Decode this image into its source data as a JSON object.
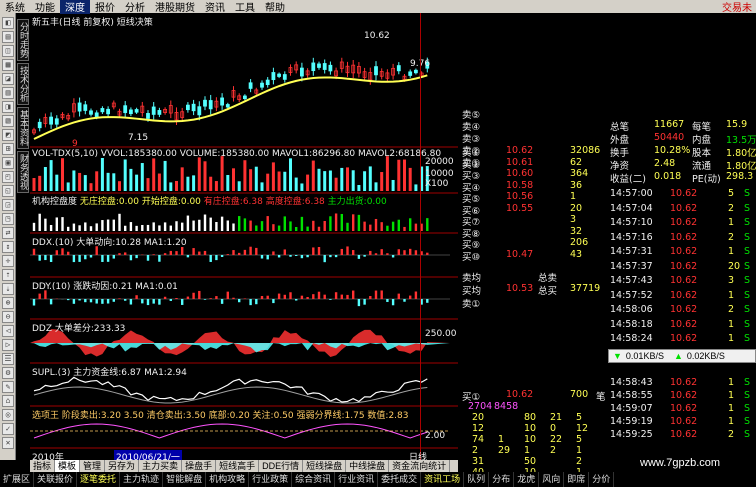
{
  "menu": {
    "items": [
      "系统",
      "功能",
      "深度",
      "报价",
      "分析",
      "港股期货",
      "资讯",
      "工具",
      "帮助"
    ],
    "active": 2,
    "trade_label": "交易未"
  },
  "vtabs": [
    "分时走势",
    "技术分析",
    "基本资料",
    "财务透视"
  ],
  "chart": {
    "title": "新五丰(日线 前复权) 短线决策",
    "mark_high": "10.62",
    "mark_low": "7.15",
    "mark_right": "9.76",
    "mark_day": "9",
    "vol_title": "VOL-TDX(5,10) VVOL:185380.00 VOLUME:185380.00 MAVOL1:86296.80 MAVOL2:68186.80",
    "vol_axis": [
      "20000",
      "10000",
      "X100"
    ],
    "jigou_title_1": "机构控盘度",
    "jigou_title_2": "无庄控盘:0.00 开始控盘:0.00",
    "jigou_title_3": "有庄控盘:6.38 高度控盘:6.38",
    "jigou_title_4": "主力出货:0.00",
    "ddx_title": "DDX.(10) 大单动向:10.28 MA1:1.20",
    "ddy_title": "DDY.(10) 涨跌动因:0.21 MA1:0.01",
    "ddz_title": "DDZ 大单差分:233.33",
    "ddz_axis": "250.00",
    "supl_title": "SUPL.(3) 主力资金线:6.87 MA1:2.94",
    "xuan_title": "选项王 阶段卖出:3.20 3.50 清仓卖出:3.50 底部:0.20 关注:0.50 强弱分界线:1.75 数值:2.83",
    "xuan_axis": "2.00",
    "year_label": "2010年",
    "date_label": "2010/06/21/一",
    "period_label": "日线"
  },
  "quote": {
    "sells": [
      {
        "label": "卖⑤",
        "price": "",
        "vol": ""
      },
      {
        "label": "卖④",
        "price": "",
        "vol": ""
      },
      {
        "label": "卖③",
        "price": "",
        "vol": ""
      },
      {
        "label": "卖②",
        "price": "",
        "vol": ""
      },
      {
        "label": "卖①",
        "price": "",
        "vol": ""
      }
    ],
    "buys": [
      {
        "label": "买①",
        "price": "10.62",
        "vol": "32086"
      },
      {
        "label": "买②",
        "price": "10.61",
        "vol": "62"
      },
      {
        "label": "买③",
        "price": "10.60",
        "vol": "364"
      },
      {
        "label": "买④",
        "price": "10.58",
        "vol": "36"
      },
      {
        "label": "买⑤",
        "price": "10.56",
        "vol": "1"
      },
      {
        "label": "买⑥",
        "price": "10.55",
        "vol": "20"
      },
      {
        "label": "买⑦",
        "price": "",
        "vol": "3"
      },
      {
        "label": "买⑧",
        "price": "",
        "vol": "32"
      },
      {
        "label": "买⑨",
        "price": "",
        "vol": "206"
      },
      {
        "label": "买⑩",
        "price": "10.47",
        "vol": "43"
      }
    ],
    "avg_sell_label": "卖均",
    "avg_buy_label": "买均",
    "avg_buy_price": "10.53",
    "total_sell_label": "总卖",
    "total_buy_label": "总买",
    "total_buy_vol": "37719",
    "sell_short": "卖①",
    "buy1_label": "买①",
    "buy1_price": "10.62",
    "buy1_vol": "700",
    "buy1_unit": "笔",
    "queue_head": [
      "2704",
      "8458"
    ],
    "queue": [
      [
        "20",
        "",
        "80",
        "21",
        "5"
      ],
      [
        "12",
        "",
        "10",
        "0",
        "12"
      ],
      [
        "74",
        "1",
        "10",
        "22",
        "5"
      ],
      [
        "2",
        "29",
        "1",
        "2",
        "1"
      ],
      [
        "31",
        "",
        "50",
        "",
        "2"
      ],
      [
        "40",
        "",
        "10",
        "",
        "1"
      ]
    ]
  },
  "info": {
    "rows": [
      {
        "l": "总笔",
        "v": "11667",
        "l2": "每笔",
        "v2": "15.9"
      },
      {
        "l": "外盘",
        "v": "50440",
        "l2": "内盘",
        "v2": "13.5万"
      },
      {
        "l": "换手",
        "v": "10.28%",
        "l2": "股本",
        "v2": "1.80亿"
      },
      {
        "l": "净资",
        "v": "2.48",
        "l2": "流通",
        "v2": "1.80亿"
      },
      {
        "l": "收益(二)",
        "v": "0.018",
        "l2": "PE(动)",
        "v2": "298.3"
      }
    ],
    "ticks": [
      {
        "t": "14:57:00",
        "p": "10.62",
        "v": "5",
        "f": "S"
      },
      {
        "t": "14:57:04",
        "p": "10.62",
        "v": "2",
        "f": "S"
      },
      {
        "t": "14:57:10",
        "p": "10.62",
        "v": "1",
        "f": "S"
      },
      {
        "t": "14:57:16",
        "p": "10.62",
        "v": "2",
        "f": "S"
      },
      {
        "t": "14:57:31",
        "p": "10.62",
        "v": "1",
        "f": "S"
      },
      {
        "t": "14:57:37",
        "p": "10.62",
        "v": "20",
        "f": "S"
      },
      {
        "t": "14:57:43",
        "p": "10.62",
        "v": "3",
        "f": "S"
      },
      {
        "t": "14:57:52",
        "p": "10.62",
        "v": "1",
        "f": "S"
      },
      {
        "t": "14:58:06",
        "p": "10.62",
        "v": "2",
        "f": "S"
      },
      {
        "t": "14:58:18",
        "p": "10.62",
        "v": "1",
        "f": "S"
      },
      {
        "t": "14:58:24",
        "p": "10.62",
        "v": "1",
        "f": "S"
      },
      {
        "t": "14:58:31",
        "p": "10.62",
        "v": "2",
        "f": "S"
      },
      {
        "t": "14:58:43",
        "p": "10.62",
        "v": "1",
        "f": "S"
      },
      {
        "t": "14:58:55",
        "p": "10.62",
        "v": "1",
        "f": "S"
      },
      {
        "t": "14:59:07",
        "p": "10.62",
        "v": "1",
        "f": "S"
      },
      {
        "t": "14:59:19",
        "p": "10.62",
        "v": "1",
        "f": "S"
      },
      {
        "t": "14:59:25",
        "p": "10.62",
        "v": "2",
        "f": "S"
      }
    ],
    "net_down": "0.01KB/S",
    "net_up": "0.02KB/S"
  },
  "bottom_tabs": [
    "指标",
    "模板",
    "管理",
    "另存为",
    "主力买卖",
    "操盘手",
    "短线高手",
    "DDE行情",
    "短线操盘",
    "中线操盘",
    "资金流向统计"
  ],
  "bottom_active": 1,
  "status": [
    "扩展区",
    "关联报价",
    "逐笔委托",
    "主力轨迹",
    "智能解盘",
    "机构攻略",
    "行业政策",
    "综合资讯",
    "行业资讯",
    "委托成交",
    "资讯工场",
    "队列",
    "分布",
    "龙虎",
    "风向",
    "即席",
    "分价"
  ],
  "watermark": "www.7gpzb.com"
}
